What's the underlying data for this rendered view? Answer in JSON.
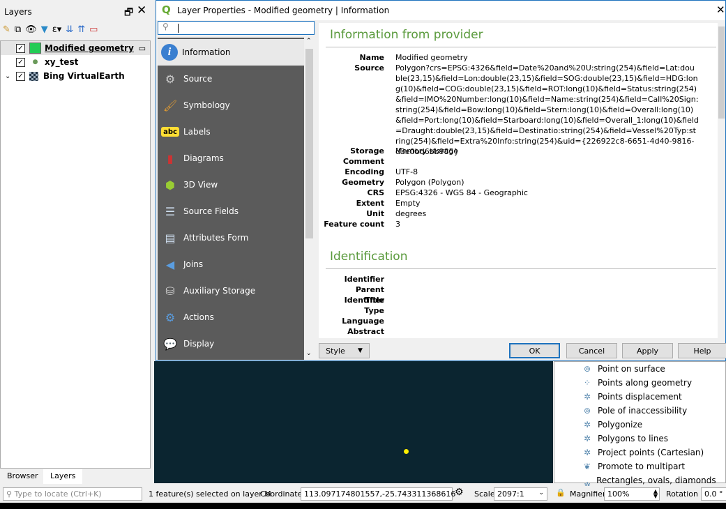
{
  "layers_panel": {
    "title": "Layers",
    "toolbar_icons": [
      "style-manager-icon",
      "add-group-icon",
      "visibility-icon",
      "filter-icon",
      "expression-filter-icon",
      "expand-all-icon",
      "collapse-all-icon",
      "remove-layer-icon"
    ],
    "items": [
      {
        "name": "Modified geometry",
        "checked": true,
        "symbol_color": "#22cc55"
      },
      {
        "name": "xy_test",
        "checked": true
      },
      {
        "name": "Bing VirtualEarth",
        "checked": true
      }
    ],
    "tabs": [
      "Browser",
      "Layers"
    ],
    "active_tab": "Layers"
  },
  "dialog": {
    "title": "Layer Properties - Modified geometry | Information",
    "search_value": "",
    "nav": [
      {
        "label": "Information",
        "icon": "info-icon",
        "selected": true
      },
      {
        "label": "Source",
        "icon": "source-icon"
      },
      {
        "label": "Symbology",
        "icon": "symbology-icon"
      },
      {
        "label": "Labels",
        "icon": "labels-icon"
      },
      {
        "label": "Diagrams",
        "icon": "diagrams-icon"
      },
      {
        "label": "3D View",
        "icon": "3d-view-icon"
      },
      {
        "label": "Source Fields",
        "icon": "source-fields-icon"
      },
      {
        "label": "Attributes Form",
        "icon": "attributes-form-icon"
      },
      {
        "label": "Joins",
        "icon": "joins-icon"
      },
      {
        "label": "Auxiliary Storage",
        "icon": "auxiliary-storage-icon"
      },
      {
        "label": "Actions",
        "icon": "actions-icon"
      },
      {
        "label": "Display",
        "icon": "display-icon"
      }
    ],
    "sections": {
      "provider_title": "Information from provider",
      "identification_title": "Identification"
    },
    "provider": [
      {
        "k": "Name",
        "v": "Modified geometry"
      },
      {
        "k": "Source",
        "v": "Polygon?crs=EPSG:4326&field=Date%20and%20U:string(254)&field=Lat:double(23,15)&field=Lon:double(23,15)&field=SOG:double(23,15)&field=HDG:long(10)&field=COG:double(23,15)&field=ROT:long(10)&field=Status:string(254)&field=IMO%20Number:long(10)&field=Name:string(254)&field=Call%20Sign:string(254)&field=Bow:long(10)&field=Stern:long(10)&field=Overall:long(10)&field=Port:long(10)&field=Starboard:long(10)&field=Overall_1:long(10)&field=Draught:double(23,15)&field=Destinatio:string(254)&field=Vessel%20Typ:string(254)&field=Extra%20Info:string(254)&uid={226922c8-6651-4d40-9816-d3e0bd6bb985}"
      },
      {
        "k": "Storage",
        "v": "Memory storage"
      },
      {
        "k": "Comment",
        "v": ""
      },
      {
        "k": "Encoding",
        "v": "UTF-8"
      },
      {
        "k": "Geometry",
        "v": "Polygon (Polygon)"
      },
      {
        "k": "CRS",
        "v": "EPSG:4326 - WGS 84 - Geographic"
      },
      {
        "k": "Extent",
        "v": "Empty"
      },
      {
        "k": "Unit",
        "v": "degrees"
      },
      {
        "k": "Feature count",
        "v": "3"
      }
    ],
    "identification": [
      {
        "k": "Identifier",
        "v": ""
      },
      {
        "k": "Parent Identifier",
        "v": ""
      },
      {
        "k": "Title",
        "v": ""
      },
      {
        "k": "Type",
        "v": ""
      },
      {
        "k": "Language",
        "v": ""
      },
      {
        "k": "Abstract",
        "v": ""
      }
    ],
    "buttons": {
      "style": "Style",
      "ok": "OK",
      "cancel": "Cancel",
      "apply": "Apply",
      "help": "Help"
    }
  },
  "processing": [
    "Point on surface",
    "Points along geometry",
    "Points displacement",
    "Pole of inaccessibility",
    "Polygonize",
    "Polygons to lines",
    "Project points (Cartesian)",
    "Promote to multipart",
    "Rectangles, ovals, diamonds (fixed)"
  ],
  "status": {
    "locate_placeholder": "Type to locate (Ctrl+K)",
    "message": "1 feature(s) selected on layer M",
    "coordinate_label": "Coordinate",
    "coordinate": "113.097174801557,-25.743311368616",
    "scale_label": "Scale",
    "scale": "2097:1",
    "magnifier_label": "Magnifier",
    "magnifier": "100%",
    "rotation_label": "Rotation",
    "rotation": "0.0 °"
  },
  "colors": {
    "accent": "#1e73be",
    "heading": "#5a9a3c",
    "nav_bg": "#5b5b5b",
    "map_bg": "#0b2530",
    "point": "#ffee00"
  }
}
